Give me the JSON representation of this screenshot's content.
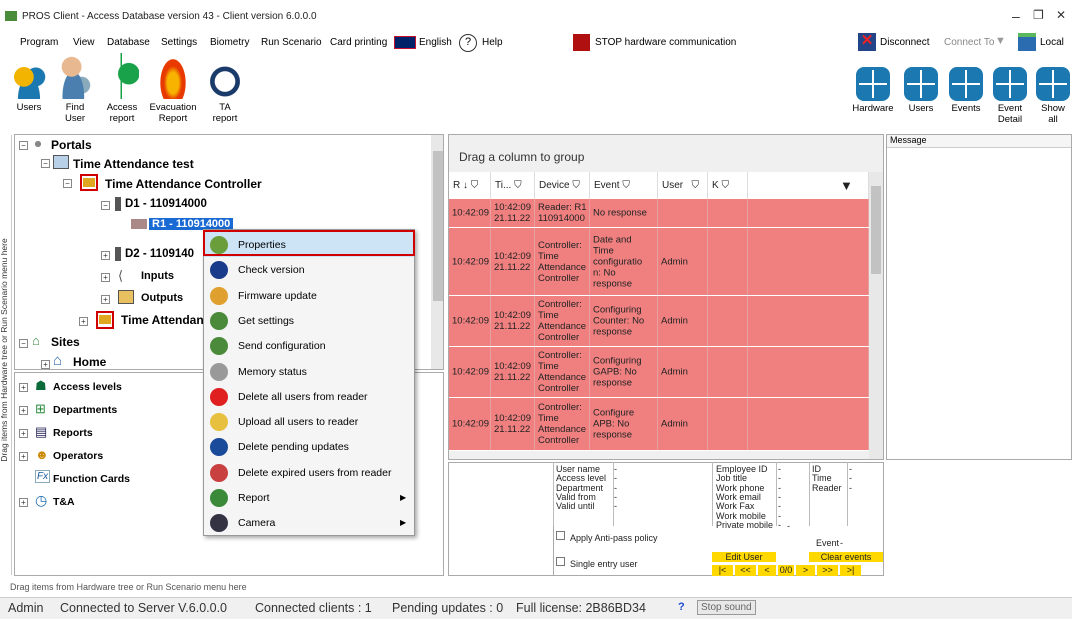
{
  "window": {
    "title": "PROS Client - Access Database version 43 - Client version 6.0.0.0",
    "minimize": "–",
    "maximize": "❐",
    "close": "✕"
  },
  "menu": [
    "Program",
    "View",
    "Database",
    "Settings",
    "Biometry",
    "Run Scenario",
    "Card printing",
    "English",
    "Help"
  ],
  "stop_hw": "STOP hardware communication",
  "connection": {
    "disconnect": "Disconnect",
    "connect_to": "Connect To",
    "local": "Local"
  },
  "ribbon_left": [
    {
      "label": "Users",
      "icon": "users-icon"
    },
    {
      "label": "Find\nUser",
      "icon": "find-user-icon"
    },
    {
      "label": "Access\nreport",
      "icon": "access-report-icon"
    },
    {
      "label": "Evacuation\nReport",
      "icon": "evacuation-icon"
    },
    {
      "label": "TA\nreport",
      "icon": "ta-report-icon"
    }
  ],
  "ribbon_right": [
    "Hardware",
    "Users",
    "Events",
    "Event\nDetail",
    "Show\nall"
  ],
  "vertical_label": "Drag items from Hardware tree or Run Scenario menu here",
  "tree": {
    "portals": "Portals",
    "ta_test": "Time Attendance test",
    "ta_controller": "Time Attendance Controller",
    "d1": "D1 - 110914000",
    "r1": "R1 - 110914000",
    "d2": "D2 - 1109140",
    "inputs": "Inputs",
    "outputs": "Outputs",
    "ta_other": "Time Attendan",
    "sites": "Sites",
    "home": "Home"
  },
  "tree2": [
    "Access levels",
    "Departments",
    "Reports",
    "Operators",
    "Function Cards",
    "T&A"
  ],
  "context_menu": [
    "Properties",
    "Check version",
    "Firmware update",
    "Get settings",
    "Send configuration",
    "Memory status",
    "Delete all users from reader",
    "Upload all users to reader",
    "Delete pending updates",
    "Delete expired users from reader",
    "Report",
    "Camera"
  ],
  "grid": {
    "drag_group": "Drag a column to group",
    "headers": [
      "R ↓",
      "Ti...",
      "Device",
      "Event",
      "User",
      "K"
    ],
    "rows": [
      {
        "r": "10:42:09",
        "t": "10:42:09\n21.11.22",
        "d": "Reader: R1 -\n110914000",
        "e": "No response",
        "u": ""
      },
      {
        "r": "10:42:09",
        "t": "10:42:09\n21.11.22",
        "d": "Controller:\nTime\nAttendance\nController",
        "e": "Date and\nTime\nconfiguratio\nn: No\nresponse",
        "u": "Admin"
      },
      {
        "r": "10:42:09",
        "t": "10:42:09\n21.11.22",
        "d": "Controller:\nTime\nAttendance\nController",
        "e": "Configuring\nCounter: No\nresponse",
        "u": "Admin"
      },
      {
        "r": "10:42:09",
        "t": "10:42:09\n21.11.22",
        "d": "Controller:\nTime\nAttendance\nController",
        "e": "Configuring\nGAPB: No\nresponse",
        "u": "Admin"
      },
      {
        "r": "10:42:09",
        "t": "10:42:09\n21.11.22",
        "d": "Controller:\nTime\nAttendance\nController",
        "e": "Configure\nAPB: No\nresponse",
        "u": "Admin"
      }
    ]
  },
  "message_header": "Message",
  "details": {
    "col1": [
      "User name",
      "Access level",
      "Department",
      "Valid from",
      "Valid until"
    ],
    "col2": [
      "Employee ID",
      "Job title",
      "Work phone",
      "Work email",
      "Work Fax",
      "Work mobile",
      "Private mobile"
    ],
    "col3": [
      "ID",
      "Time",
      "Reader"
    ],
    "dash": "-",
    "event": "Event",
    "apply_apb": "Apply Anti-pass policy",
    "single_entry": "Single entry user",
    "edit_user": "Edit User",
    "clear_events": "Clear events",
    "nav": [
      "|<",
      "<<",
      "<",
      "0/0",
      ">",
      ">>",
      ">|"
    ]
  },
  "bottom_drag": "Drag items from Hardware tree or Run Scenario menu here",
  "status": {
    "user": "Admin",
    "server": "Connected to Server  V.6.0.0.0",
    "clients": "Connected clients : 1",
    "pending": "Pending updates : 0",
    "license": "Full license: 2B86BD34",
    "q": "?",
    "stop_sound": "Stop sound"
  },
  "colors": {
    "event_row": "#f08080",
    "accent": "#1c78b0",
    "highlight": "#d10000",
    "yellow": "#ffd800"
  }
}
